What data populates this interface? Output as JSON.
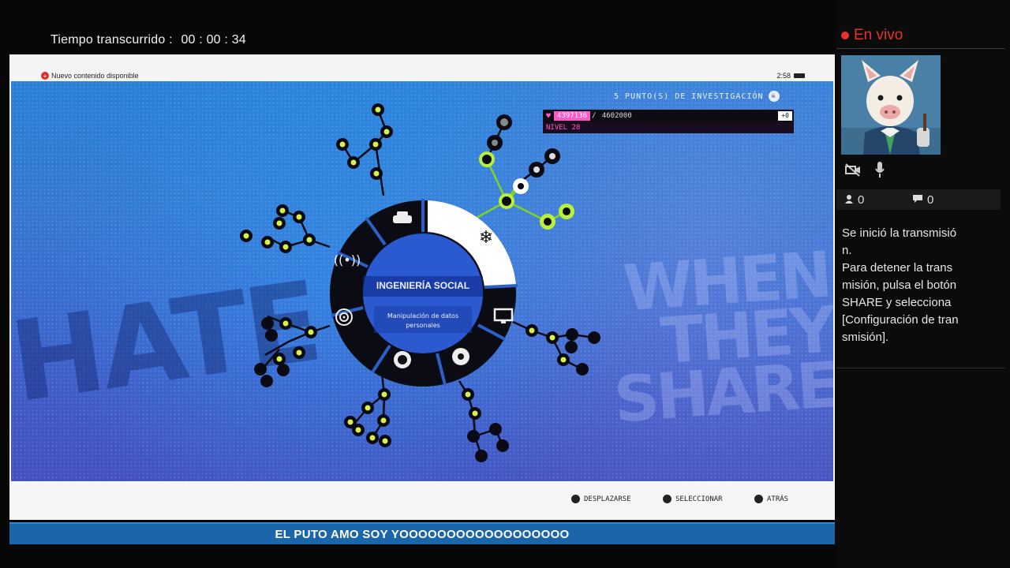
{
  "stream": {
    "elapsed_label": "Tiempo transcurrido :",
    "elapsed_time": "00 : 00 : 34"
  },
  "system": {
    "notice": "Nuevo contenido disponible",
    "clock": "2:58"
  },
  "game": {
    "research_points": "5 PUNTO(S) DE INVESTIGACIÓN",
    "followers_current": "4397136",
    "followers_max": "4602000",
    "xp_chip": "+0",
    "level": "NIVEL 28",
    "wheel_title": "INGENIERÍA SOCIAL",
    "wheel_subtitle_1": "Manipulación de datos",
    "wheel_subtitle_2": "personales",
    "hints": [
      {
        "label": "DESPLAZARSE"
      },
      {
        "label": "SELECCIONAR"
      },
      {
        "label": "ATRÁS"
      }
    ],
    "accent_colors": {
      "highlight": "#b8f03a",
      "followers": "#ff57c9"
    }
  },
  "banner": {
    "title": "EL PUTO AMO SOY YOOOOOOOOOOOOOOOOOO"
  },
  "sidebar": {
    "live_label": "En vivo",
    "viewers": "0",
    "comments": "0",
    "message_1": "Se inició la transmisión.",
    "message_2": "Para detener la transmisión, pulsa el botón SHARE y selecciona [Configuración de transmisión]."
  }
}
